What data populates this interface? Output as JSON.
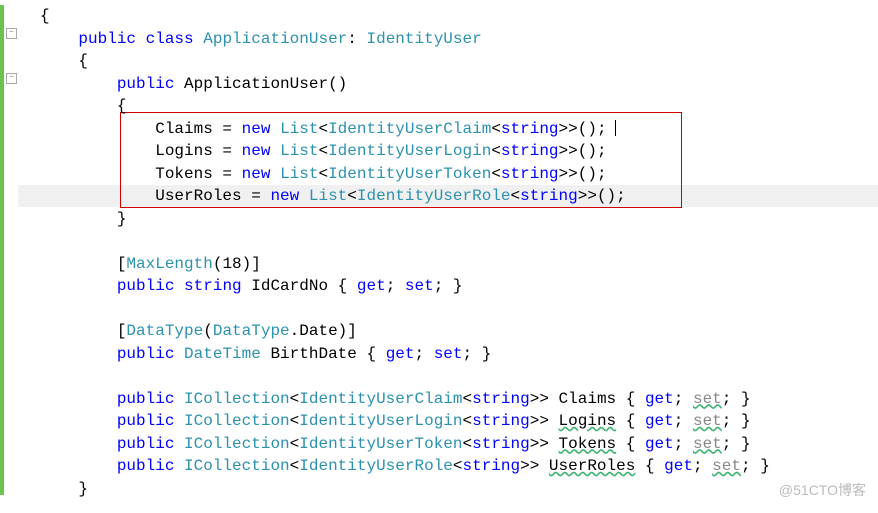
{
  "class_decl": {
    "kw_public": "public",
    "kw_class": "class",
    "name": "ApplicationUser",
    "base": "IdentityUser"
  },
  "ctor": {
    "kw_public": "public",
    "name": "ApplicationUser",
    "lines": [
      {
        "prop": "Claims",
        "eq": " = ",
        "kw_new": "new",
        "list": "List",
        "generic": "IdentityUserClaim",
        "inner": "string",
        "tail": ">>();"
      },
      {
        "prop": "Logins",
        "eq": " = ",
        "kw_new": "new",
        "list": "List",
        "generic": "IdentityUserLogin",
        "inner": "string",
        "tail": ">>();"
      },
      {
        "prop": "Tokens",
        "eq": " = ",
        "kw_new": "new",
        "list": "List",
        "generic": "IdentityUserToken",
        "inner": "string",
        "tail": ">>();"
      },
      {
        "prop": "UserRoles",
        "eq": " = ",
        "kw_new": "new",
        "list": "List",
        "generic": "IdentityUserRole",
        "inner": "string",
        "tail": ">>();"
      }
    ]
  },
  "maxlen_attr": {
    "open": "[",
    "name": "MaxLength",
    "args": "(18)",
    "close": "]"
  },
  "idcard_prop": {
    "kw_public": "public",
    "kw_type": "string",
    "name": "IdCardNo",
    "open": " { ",
    "get": "get",
    "semi1": "; ",
    "set": "set",
    "semi2": "; ",
    "close": "}"
  },
  "datatype_attr": {
    "open": "[",
    "name": "DataType",
    "paren": "(",
    "enum": "DataType",
    "dot": ".Date)",
    "close": "]"
  },
  "birth_prop": {
    "kw_public": "public",
    "type": "DateTime",
    "name": "BirthDate",
    "open": " { ",
    "get": "get",
    "semi1": "; ",
    "set": "set",
    "semi2": "; ",
    "close": "}"
  },
  "collections": [
    {
      "kw_public": "public",
      "icol": "ICollection",
      "generic": "IdentityUserClaim",
      "inner": "string",
      "name": "Claims",
      "get": "get",
      "set": "set"
    },
    {
      "kw_public": "public",
      "icol": "ICollection",
      "generic": "IdentityUserLogin",
      "inner": "string",
      "name": "Logins",
      "get": "get",
      "set": "set"
    },
    {
      "kw_public": "public",
      "icol": "ICollection",
      "generic": "IdentityUserToken",
      "inner": "string",
      "name": "Tokens",
      "get": "get",
      "set": "set"
    },
    {
      "kw_public": "public",
      "icol": "ICollection",
      "generic": "IdentityUserRole",
      "inner": "string",
      "name": "UserRoles",
      "get": "get",
      "set": "set"
    }
  ],
  "braces": {
    "open": "{",
    "close": "}"
  },
  "watermark": "@51CTO博客"
}
